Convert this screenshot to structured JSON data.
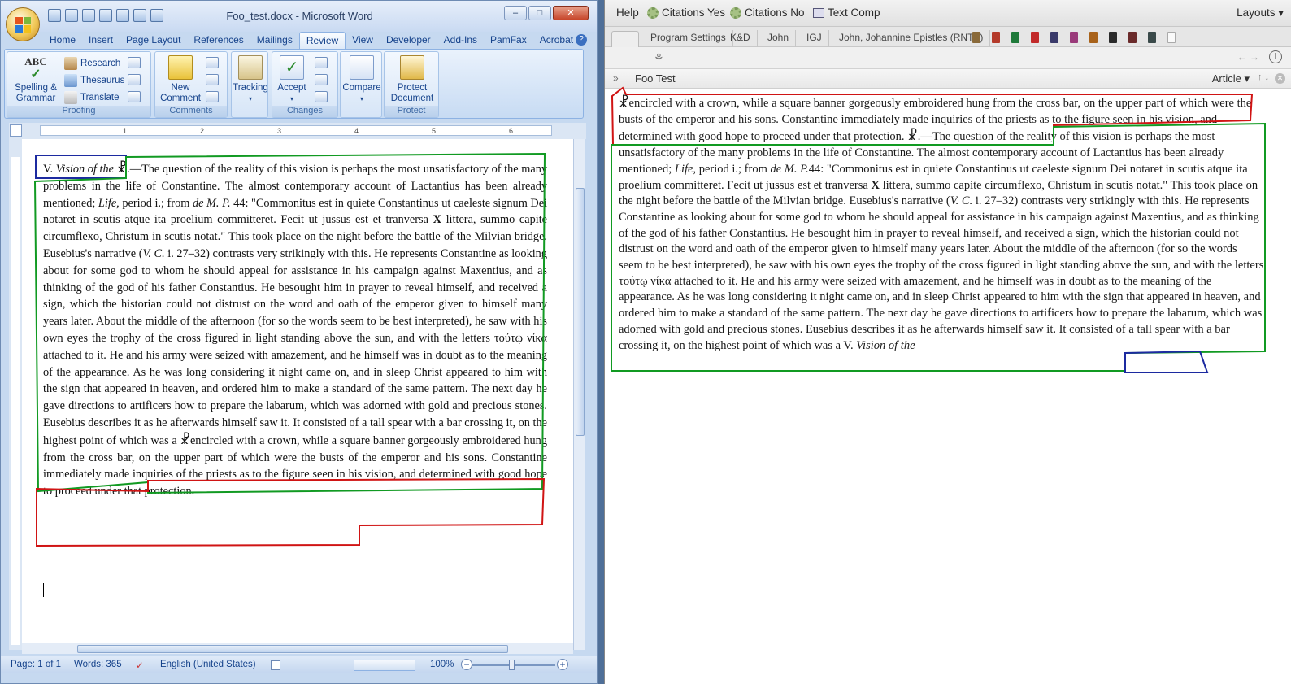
{
  "word": {
    "title": "Foo_test.docx - Microsoft Word",
    "window_controls": {
      "minimize": "–",
      "maximize": "□",
      "close": "✕"
    },
    "tabs": [
      "Home",
      "Insert",
      "Page Layout",
      "References",
      "Mailings",
      "Review",
      "View",
      "Developer",
      "Add-Ins",
      "PamFax",
      "Acrobat"
    ],
    "active_tab": "Review",
    "ribbon": {
      "proofing": {
        "label": "Proofing",
        "spelling": "Spelling &",
        "grammar": "Grammar",
        "research": "Research",
        "thesaurus": "Thesaurus",
        "translate": "Translate"
      },
      "comments": {
        "label": "Comments",
        "new_comment_1": "New",
        "new_comment_2": "Comment"
      },
      "tracking": {
        "label": "Tracking"
      },
      "changes": {
        "label": "Changes",
        "accept": "Accept"
      },
      "compare": {
        "label": "Compare"
      },
      "protect": {
        "label": "Protect",
        "protect_1": "Protect",
        "protect_2": "Document"
      }
    },
    "ruler_numbers": [
      "1",
      "2",
      "3",
      "4",
      "5",
      "6"
    ],
    "document": {
      "p1_roman": "V.",
      "p1_vision": "Vision of the",
      "chirho": "☧",
      "p1_dash": ".—The question of the reality of this vision is perhaps the most unsatisfactory of the many problems in the life of Constantine. The almost contemporary account of Lactantius has been already mentioned;",
      "p1_life": "Life,",
      "p1_b": "period i.; from",
      "p1_dmp": "de M. P.",
      "p1_c": "44: \"Commonitus est in quiete Constantinus ut caeleste signum Dei notaret in scutis atque ita proelium committeret. Fecit ut jussus est et tranversa",
      "p1_x": "X",
      "p1_d": "littera, summo capite circumflexo, Christum in scutis notat.\" This took place on the night before the battle of the Milvian bridge. Eusebius's narrative (",
      "p1_vc": "V. C.",
      "p1_e": "i. 27–32) contrasts very strikingly with this. He represents Constantine as looking about for some god to whom he should appeal for assistance in his campaign against Maxentius, and as thinking of the god of his father Constantius. He besought him in prayer to reveal himself, and received a sign, which the historian could not distrust on the word and oath of the emperor given to himself many years later. About the middle of the afternoon (for so the words seem to be best interpreted), he saw with his own eyes the trophy of the cross figured in light standing above the sun, and with the letters",
      "p1_greek": "τούτῳ νίκα",
      "p1_f": "attached to it. He and his army were seized with amazement, and he himself was in doubt as to the meaning of the appearance. As he was long considering it night came on, and in sleep Christ appeared to him with the sign that appeared in heaven, and ordered him to make a standard of the same pattern. The next day he gave directions to artificers how to prepare the labarum, which was adorned with gold and precious stones. Eusebius describes it as he afterwards himself saw it. It consisted of a tall spear with a bar crossing it, on the highest point of which was a",
      "p1_g": "encircled with a crown, while a square banner gorgeously embroidered hung from the cross bar, on the upper part of which were the busts of the emperor and his sons. Constantine immediately made inquiries of the priests as to the figure seen in his vision, and determined with good hope to proceed under that protection."
    },
    "status": {
      "page": "Page: 1 of 1",
      "words": "Words: 365",
      "language": "English (United States)",
      "zoom": "100%",
      "zoom_minus": "−",
      "zoom_plus": "+"
    }
  },
  "logos": {
    "toolbar": {
      "help": "Help",
      "citations_yes": "Citations Yes",
      "citations_no": "Citations No",
      "text_comp": "Text Comp",
      "layouts": "Layouts"
    },
    "tabs": [
      "Program Settings",
      "K&D",
      "John",
      "IGJ",
      "John, Johannine Epistles (RNTS)"
    ],
    "panel_title": "Foo Test",
    "article_label": "Article",
    "text": {
      "a": "encircled with a crown, while a square banner gorgeously embroidered hung from the cross bar, on the upper part of which were the busts of the emperor and his sons. Constantine immediately made inquiries of the priests as to the figure seen in his vision, and determined with good hope to proceed under that protection.",
      "b": ".—The question of the reality of this vision is perhaps the most unsatisfactory of the many problems in the life of Constantine. The almost contemporary account of Lactantius has been already mentioned;",
      "life": "Life,",
      "c": "period i.; from",
      "dmp": "de M. P.",
      "d": "44: \"Commonitus est in quiete Constantinus ut caeleste signum Dei notaret in scutis atque ita proelium committeret. Fecit ut jussus est et tranversa",
      "x": "X",
      "e": "littera, summo capite circumflexo, Christum in scutis notat.\" This took place on the night before the battle of the Milvian bridge. Eusebius's narrative (",
      "vc": "V. C.",
      "f": "i. 27–32) contrasts very strikingly with this. He represents Constantine as looking about for some god to whom he should appeal for assistance in his campaign against Maxentius, and as thinking of the god of his father Constantius. He besought him in prayer to reveal himself, and received a sign, which the historian could not distrust on the word and oath of the emperor given to himself many years later. About the middle of the afternoon (for so the words seem to be best interpreted), he saw with his own eyes the trophy of the cross figured in light standing above the sun, and with the letters",
      "greek": "τούτῳ νίκα",
      "g": "attached to it. He and his army were seized with amazement, and he himself was in doubt as to the meaning of the appearance. As he was long considering it night came on, and in sleep Christ appeared to him with the sign that appeared in heaven, and ordered him to make a standard of the same pattern. The next day he gave directions to artificers how to prepare the labarum, which was adorned with gold and precious stones. Eusebius describes it as he afterwards himself saw it. It consisted of a tall spear with a bar crossing it, on the highest point of which was a",
      "roman": "V.",
      "vision": "Vision of the"
    }
  },
  "colors": {
    "red_box": "#d01414",
    "green_box": "#119a22",
    "blue_box": "#1c2aa0",
    "word_accent": "#15428b"
  }
}
